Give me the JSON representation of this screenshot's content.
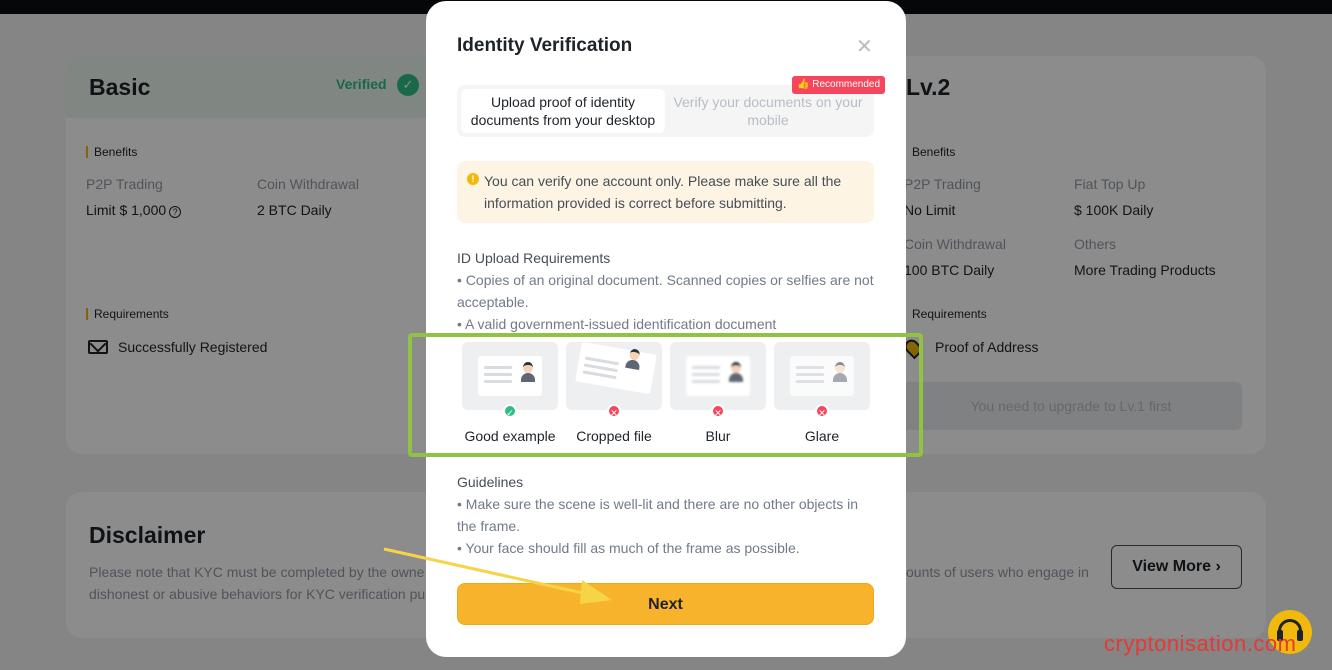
{
  "background": {
    "basic": {
      "title": "Basic",
      "status": "Verified",
      "benefits_label": "Benefits",
      "benefits": [
        {
          "name": "P2P Trading",
          "value": "Limit $ 1,000"
        },
        {
          "name": "Coin Withdrawal",
          "value": "2 BTC Daily"
        }
      ],
      "requirements_label": "Requirements",
      "requirement": "Successfully Registered"
    },
    "lv2": {
      "title": "Lv.2",
      "benefits_label": "Benefits",
      "benefits": [
        {
          "name": "P2P Trading",
          "value": "No Limit"
        },
        {
          "name": "Fiat Top Up",
          "value": "$ 100K Daily"
        },
        {
          "name": "Coin Withdrawal",
          "value": "100 BTC Daily"
        },
        {
          "name": "Others",
          "value": "More Trading Products"
        }
      ],
      "requirements_label": "Requirements",
      "requirement": "Proof of Address",
      "upgrade_button": "You need to upgrade to Lv.1 first"
    },
    "disclaimer": {
      "title": "Disclaimer",
      "text_left_line1": "Please note that KYC must be completed by the owne",
      "text_left_line2": "dishonest or abusive behaviors for KYC verification pu",
      "text_right": "ounts of users who engage in",
      "view_more": "View More"
    }
  },
  "modal": {
    "title": "Identity Verification",
    "tabs": [
      {
        "label": "Upload proof of identity documents from your desktop",
        "active": true
      },
      {
        "label": "Verify your documents on your mobile",
        "active": false
      }
    ],
    "recommended_badge": "Recommended",
    "warning": "You can verify one account only. Please make sure all the information provided is correct before submitting.",
    "requirements_heading": "ID Upload Requirements",
    "requirements": [
      "• Copies of an original document. Scanned copies or selfies are not acceptable.",
      "• A valid government-issued identification document"
    ],
    "examples": [
      {
        "label": "Good example",
        "status": "ok"
      },
      {
        "label": "Cropped file",
        "status": "bad"
      },
      {
        "label": "Blur",
        "status": "bad"
      },
      {
        "label": "Glare",
        "status": "bad"
      }
    ],
    "guidelines_heading": "Guidelines",
    "guidelines": [
      "• Make sure the scene is well-lit and there are no other objects in the frame.",
      "• Your face should fill as much of the frame as possible."
    ],
    "next_button": "Next"
  },
  "watermark": "cryptonisation.com",
  "colors": {
    "accent": "#f7b32b",
    "success": "#2ebd85",
    "danger": "#f6465d",
    "highlight": "#8fc341",
    "annotation_arrow": "#f5d547"
  }
}
